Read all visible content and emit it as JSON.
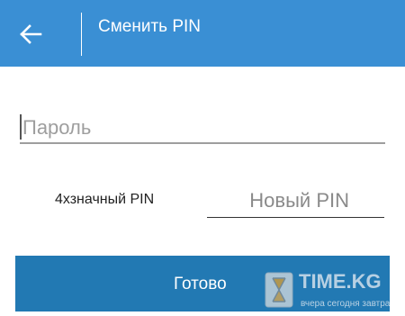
{
  "header": {
    "title": "Сменить PIN",
    "back_icon": "arrow-left-icon",
    "color": "#3a8fd4"
  },
  "form": {
    "password": {
      "placeholder": "Пароль",
      "value": ""
    },
    "pin": {
      "label": "4хзначный PIN",
      "placeholder": "Новый PIN",
      "value": ""
    }
  },
  "actions": {
    "done_label": "Готово",
    "done_color": "#2279b3"
  },
  "watermark": {
    "title": "TIME.KG",
    "subtitle": "вчера сегодня завтра"
  }
}
